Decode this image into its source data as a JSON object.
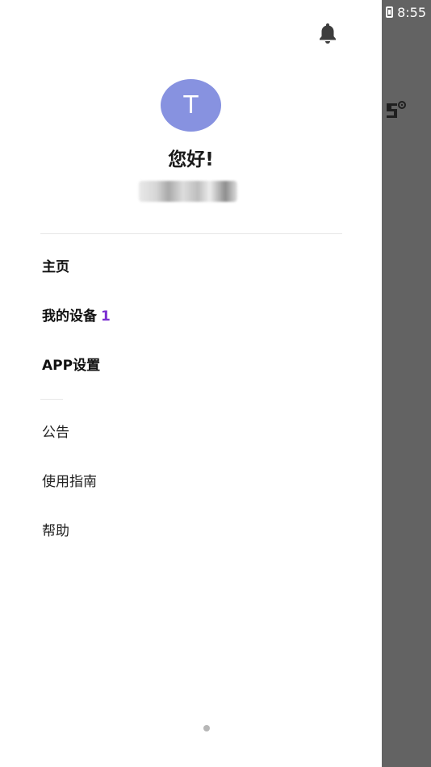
{
  "status_bar": {
    "time": "8:55",
    "battery_icon": "battery-charging-icon"
  },
  "drawer": {
    "notification_icon": "bell-icon",
    "avatar_initial": "T",
    "greeting": "您好!",
    "account_name_blurred": true,
    "primary_menu": [
      {
        "label": "主页"
      },
      {
        "label": "我的设备",
        "count": "1"
      },
      {
        "label": "APP设置"
      }
    ],
    "secondary_menu": [
      {
        "label": "公告"
      },
      {
        "label": "使用指南"
      },
      {
        "label": "帮助"
      }
    ]
  },
  "colors": {
    "avatar_bg": "#8792e0",
    "count_accent": "#7b2fd1",
    "scrim": "#636363"
  }
}
